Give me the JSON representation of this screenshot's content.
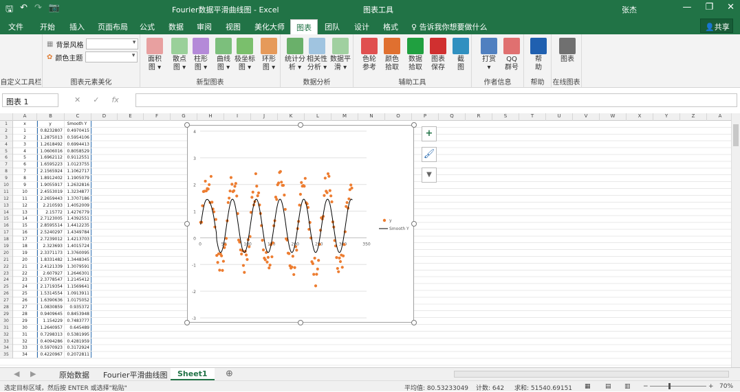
{
  "window": {
    "doc_title": "Fourier数据平滑曲线图 - Excel",
    "context_title": "图表工具",
    "user": "张杰",
    "minimize_glyph": "—",
    "restore_glyph": "❐",
    "close_glyph": "✕",
    "save_glyph": "🖫",
    "undo_glyph": "↶",
    "redo_glyph": "↷",
    "camera_glyph": "📷"
  },
  "tabs": [
    {
      "label": "文件"
    },
    {
      "label": "开始"
    },
    {
      "label": "插入"
    },
    {
      "label": "页面布局"
    },
    {
      "label": "公式"
    },
    {
      "label": "数据"
    },
    {
      "label": "审阅"
    },
    {
      "label": "视图"
    },
    {
      "label": "美化大师"
    },
    {
      "label": "图表"
    },
    {
      "label": "团队"
    },
    {
      "label": "设计"
    },
    {
      "label": "格式"
    }
  ],
  "tell_me": "告诉我你想要做什么",
  "share_label": "共享",
  "ribbon": {
    "g1_label": "自定义工具栏",
    "g2_label": "图表元素美化",
    "bg_style_label": "背景风格",
    "color_theme_label": "颜色主题",
    "g3_label": "新型图表",
    "g4_label": "数据分析",
    "g5_label": "辅助工具",
    "g6_label": "作者信息",
    "g7_label": "帮助",
    "g8_label": "在线图表",
    "buttons": [
      {
        "label": "面积\n图 ▾",
        "icon": "area-chart-icon",
        "color": "#e8a0a0"
      },
      {
        "label": "散点\n图 ▾",
        "icon": "scatter-chart-icon",
        "color": "#9ad09a"
      },
      {
        "label": "柱形\n图 ▾",
        "icon": "column-chart-icon",
        "color": "#b48ad8"
      },
      {
        "label": "曲线\n图 ▾",
        "icon": "curve-chart-icon",
        "color": "#7cbf7c"
      },
      {
        "label": "极坐标\n图 ▾",
        "icon": "polar-chart-icon",
        "color": "#7abf6c"
      },
      {
        "label": "环形\n图 ▾",
        "icon": "donut-chart-icon",
        "color": "#e69a5a"
      },
      {
        "label": "统计分\n析 ▾",
        "icon": "statistics-icon",
        "color": "#6ab06a"
      },
      {
        "label": "相关性\n分析 ▾",
        "icon": "correlation-icon",
        "color": "#a0c4e0"
      },
      {
        "label": "数据平\n滑 ▾",
        "icon": "smooth-icon",
        "color": "#a0d0a0"
      },
      {
        "label": "色轮\n参考",
        "icon": "color-wheel-icon",
        "color": "#e05050"
      },
      {
        "label": "颜色\n拾取",
        "icon": "color-picker-icon",
        "color": "#e07030"
      },
      {
        "label": "数据\n拾取",
        "icon": "data-picker-icon",
        "color": "#20a040"
      },
      {
        "label": "图表\n保存",
        "icon": "chart-save-icon",
        "color": "#d03030"
      },
      {
        "label": "截\n图",
        "icon": "screenshot-icon",
        "color": "#3090c0"
      },
      {
        "label": "打赏\n▾",
        "icon": "qr-reward-icon",
        "color": "#5080c0"
      },
      {
        "label": "QQ\n群号",
        "icon": "qq-group-icon",
        "color": "#e07070"
      },
      {
        "label": "帮\n助",
        "icon": "help-icon",
        "color": "#2060b0"
      },
      {
        "label": "图表",
        "icon": "online-chart-icon",
        "color": "#707070"
      }
    ]
  },
  "formula_bar": {
    "name_box": "图表 1",
    "cancel_glyph": "✕",
    "enter_glyph": "✓",
    "fx_glyph": "fx"
  },
  "columns": [
    "A",
    "B",
    "C",
    "D",
    "E",
    "F",
    "G",
    "H",
    "I",
    "J",
    "K",
    "L",
    "M",
    "N",
    "O",
    "P",
    "Q",
    "R",
    "S",
    "T",
    "U",
    "V",
    "W",
    "X",
    "Y",
    "Z",
    "A"
  ],
  "rows": [
    [
      "x",
      "y",
      "Smooth Y"
    ],
    [
      "1",
      "0.8232807",
      "0.4970415"
    ],
    [
      "2",
      "1.2875013",
      "0.5954106"
    ],
    [
      "3",
      "1.2618492",
      "0.6994413"
    ],
    [
      "4",
      "1.0606016",
      "0.8058529"
    ],
    [
      "5",
      "1.6962112",
      "0.9112551"
    ],
    [
      "6",
      "1.6595223",
      "1.0123755"
    ],
    [
      "7",
      "2.1565924",
      "1.1062717"
    ],
    [
      "8",
      "1.8912402",
      "1.1905079"
    ],
    [
      "9",
      "1.9055917",
      "1.2632816"
    ],
    [
      "10",
      "2.4553019",
      "1.3234877"
    ],
    [
      "11",
      "2.2659443",
      "1.3707186"
    ],
    [
      "12",
      "2.210593",
      "1.4052009"
    ],
    [
      "13",
      "2.15772",
      "1.4276779"
    ],
    [
      "14",
      "2.7123005",
      "1.4392551"
    ],
    [
      "15",
      "2.8595514",
      "1.4412235"
    ],
    [
      "16",
      "2.5240297",
      "1.4349784"
    ],
    [
      "17",
      "2.7239012",
      "1.4213703"
    ],
    [
      "18",
      "2.323693",
      "1.4015724"
    ],
    [
      "19",
      "2.3371173",
      "1.3760095"
    ],
    [
      "20",
      "1.8331482",
      "1.3448345"
    ],
    [
      "21",
      "2.4121339",
      "1.3079591"
    ],
    [
      "22",
      "2.607927",
      "1.2646301"
    ],
    [
      "23",
      "2.3778547",
      "1.2145412"
    ],
    [
      "24",
      "2.1719354",
      "1.1569641"
    ],
    [
      "25",
      "1.5314554",
      "1.0913911"
    ],
    [
      "26",
      "1.6390636",
      "1.0175052"
    ],
    [
      "27",
      "1.0830859",
      "0.935372"
    ],
    [
      "28",
      "0.9409645",
      "0.8453948"
    ],
    [
      "29",
      "1.154229",
      "0.7483777"
    ],
    [
      "30",
      "1.2640957",
      "0.645489"
    ],
    [
      "31",
      "0.7298313",
      "0.5381995"
    ],
    [
      "32",
      "0.4094286",
      "0.4281959"
    ],
    [
      "33",
      "0.5970923",
      "0.3172924"
    ],
    [
      "34",
      "0.4220967",
      "0.2072811"
    ]
  ],
  "row_numbers": [
    "1",
    "2",
    "3",
    "4",
    "5",
    "6",
    "7",
    "8",
    "9",
    "10",
    "11",
    "12",
    "13",
    "14",
    "15",
    "16",
    "17",
    "18",
    "19",
    "20",
    "21",
    "22",
    "23",
    "24",
    "25",
    "26",
    "27",
    "28",
    "29",
    "30",
    "31",
    "32",
    "33",
    "34",
    "35"
  ],
  "chart_data": {
    "type": "scatter",
    "title": "",
    "xlabel": "",
    "ylabel": "",
    "xlim": [
      0,
      350
    ],
    "ylim": [
      -3,
      4
    ],
    "x_ticks": [
      "0",
      "50",
      "100",
      "150",
      "200",
      "250",
      "300",
      "350"
    ],
    "y_ticks": [
      "4",
      "3",
      "2",
      "1",
      "0",
      "-1",
      "-2",
      "-3"
    ],
    "grid": true,
    "legend": "right",
    "series": [
      {
        "name": "y",
        "kind": "scatter",
        "color": "#ed7d31"
      },
      {
        "name": "Smooth Y",
        "kind": "line",
        "color": "#000000"
      }
    ],
    "smooth_y_first_values": [
      0.497,
      0.595,
      0.699,
      0.806,
      0.911,
      1.012,
      1.106,
      1.191,
      1.263,
      1.323,
      1.371,
      1.405,
      1.428,
      1.439,
      1.441,
      1.435,
      1.421,
      1.402,
      1.376,
      1.345,
      1.308,
      1.265,
      1.215,
      1.157,
      1.091,
      1.018,
      0.935,
      0.845,
      0.748,
      0.645,
      0.538,
      0.428,
      0.317,
      0.207
    ]
  },
  "chart_buttons": {
    "add": "+",
    "style": "🖌",
    "filter": "▼"
  },
  "sheet_tabs": [
    "原始数据",
    "Fourier平滑曲线图",
    "Sheet1"
  ],
  "sheet_add": "⊕",
  "status": {
    "message": "选定目标区域，然后按 ENTER 或选择\"粘贴\"",
    "average": "平均值: 80.53233049",
    "count": "计数: 642",
    "sum": "求和: 51540.69151",
    "zoom": "70%"
  }
}
